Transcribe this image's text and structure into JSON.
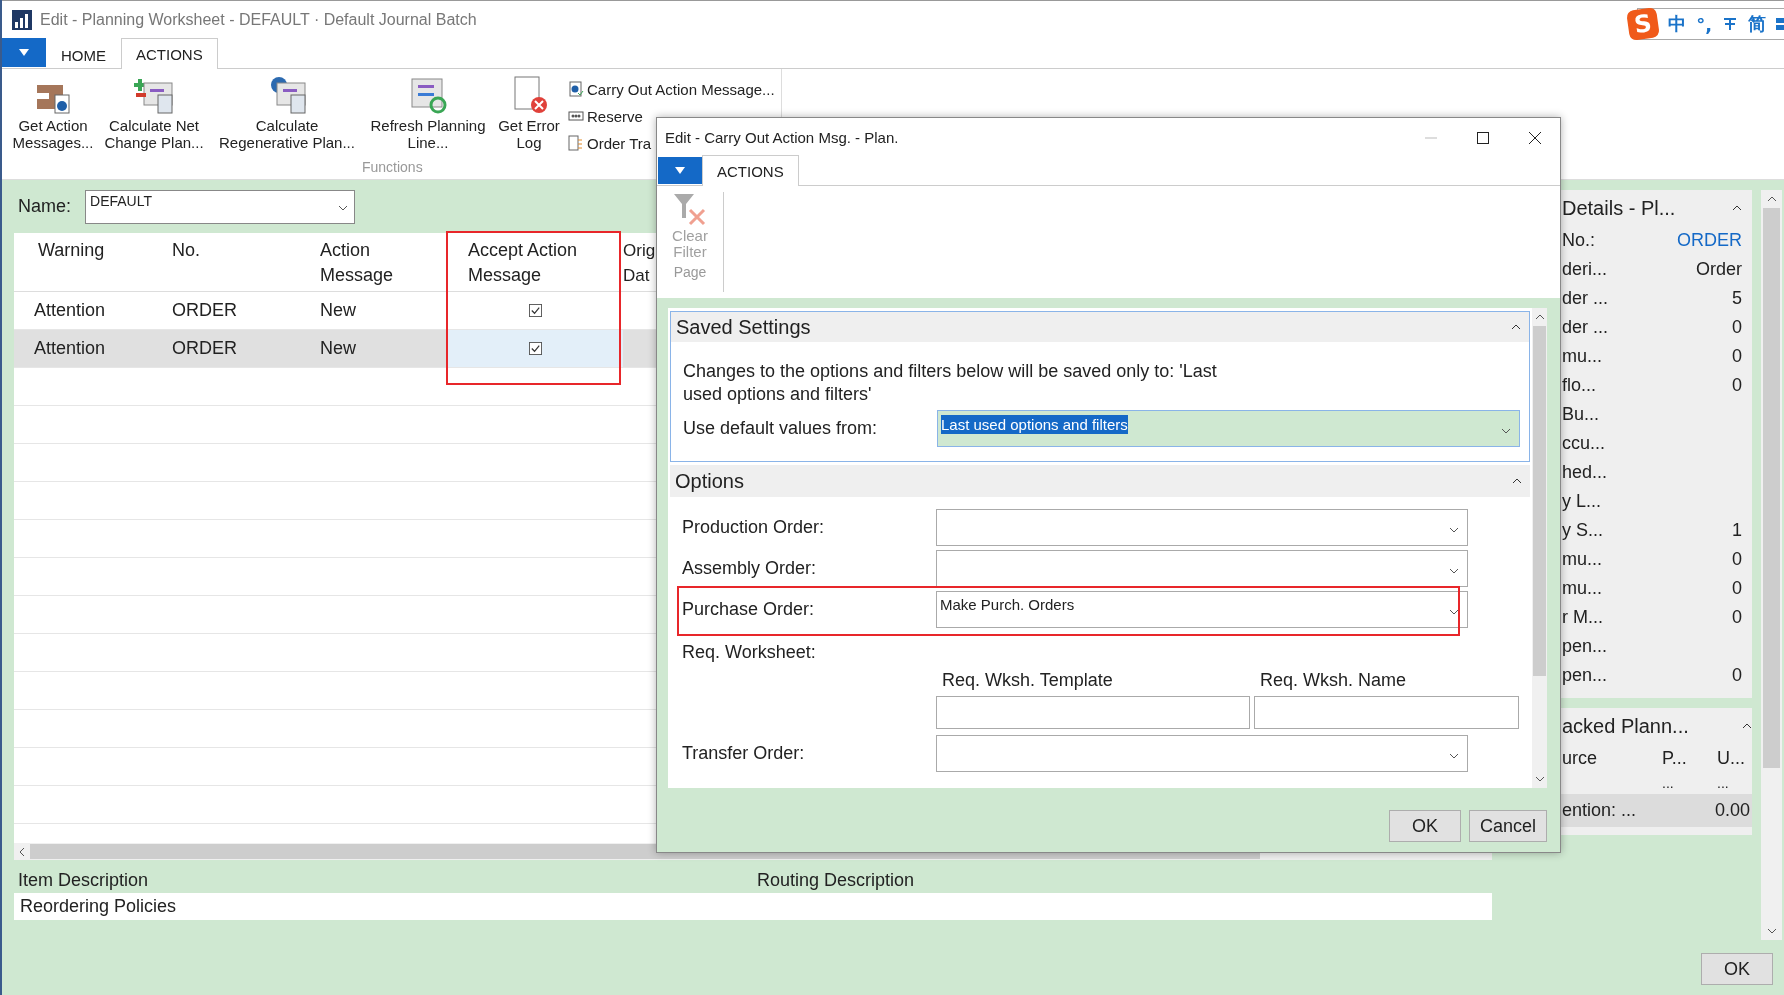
{
  "window": {
    "title": "Edit - Planning Worksheet - DEFAULT · Default Journal Batch"
  },
  "ime": {
    "logo": "S",
    "mode": "中",
    "punctuation": "°,",
    "script": "简"
  },
  "ribbon": {
    "tabs": [
      {
        "label": "HOME",
        "selected": false
      },
      {
        "label": "ACTIONS",
        "selected": true
      }
    ],
    "group": "Functions",
    "large_items": [
      "Get Action Messages...",
      "Calculate Net Change Plan...",
      "Calculate Regenerative Plan...",
      "Refresh Planning Line...",
      "Get Error Log"
    ],
    "small_items": [
      "Carry Out Action Message...",
      "Reserve",
      "Order Tra"
    ]
  },
  "batch": {
    "label": "Name:",
    "value": "DEFAULT"
  },
  "grid": {
    "columns": [
      "Warning",
      "No.",
      "Action Message",
      "Accept Action Message",
      "Orig Dat"
    ],
    "rows": [
      {
        "warning": "Attention",
        "no": "ORDER",
        "action_message": "New",
        "accept": true,
        "selected": false
      },
      {
        "warning": "Attention",
        "no": "ORDER",
        "action_message": "New",
        "accept": true,
        "selected": true
      }
    ]
  },
  "footer": {
    "item_description_label": "Item Description",
    "routing_description_label": "Routing Description",
    "item_description": "Reordering Policies"
  },
  "details": {
    "title": "Details - Pl...",
    "rows": [
      {
        "label": "No.:",
        "value": "ORDER",
        "kind": "link"
      },
      {
        "label": "deri...",
        "value": "Order",
        "kind": "text"
      },
      {
        "label": "der ...",
        "value": "5",
        "kind": "text"
      },
      {
        "label": "der ...",
        "value": "0",
        "kind": "text"
      },
      {
        "label": "mu...",
        "value": "0",
        "kind": "text"
      },
      {
        "label": "flo...",
        "value": "0",
        "kind": "text"
      },
      {
        "label": "Bu..."
      },
      {
        "label": "ccu..."
      },
      {
        "label": "hed..."
      },
      {
        "label": "y L..."
      },
      {
        "label": "y S...",
        "value": "1",
        "kind": "text"
      },
      {
        "label": "mu...",
        "value": "0",
        "kind": "text"
      },
      {
        "label": "mu...",
        "value": "0",
        "kind": "text"
      },
      {
        "label": "r M...",
        "value": "0",
        "kind": "text"
      },
      {
        "label": "pen..."
      },
      {
        "label": "pen...",
        "value": "0",
        "kind": "text"
      }
    ]
  },
  "tracking": {
    "title": "acked Plann...",
    "columns": [
      "urce",
      "P...",
      "U..."
    ],
    "row": [
      "...",
      "..."
    ],
    "total": {
      "label": "ention: ...",
      "value": "0.00"
    }
  },
  "ok_button": "OK",
  "dialog": {
    "title": "Edit - Carry Out Action Msg. - Plan.",
    "tabs": [
      {
        "label": "ACTIONS",
        "selected": true
      }
    ],
    "action": {
      "label": "Clear Filter",
      "disabled": true
    },
    "group": "Page",
    "saved_settings": {
      "title": "Saved Settings",
      "note": "Changes to the options and filters below will be saved only to: 'Last used options and filters'",
      "default_label": "Use default values from:",
      "default_value": "Last used options and filters"
    },
    "options": {
      "title": "Options",
      "fields": [
        {
          "kind": "dropdown",
          "label": "Production Order:"
        },
        {
          "kind": "dropdown",
          "label": "Assembly Order:"
        },
        {
          "kind": "dropdown",
          "label": "Purchase Order:",
          "value": "Make Purch. Orders"
        },
        {
          "kind": "pair",
          "label": "Req. Worksheet:",
          "columns": [
            "Req. Wksh. Template",
            "Req. Wksh. Name"
          ]
        },
        {
          "kind": "dropdown",
          "label": "Transfer Order:"
        }
      ]
    },
    "buttons": [
      "OK",
      "Cancel"
    ]
  }
}
